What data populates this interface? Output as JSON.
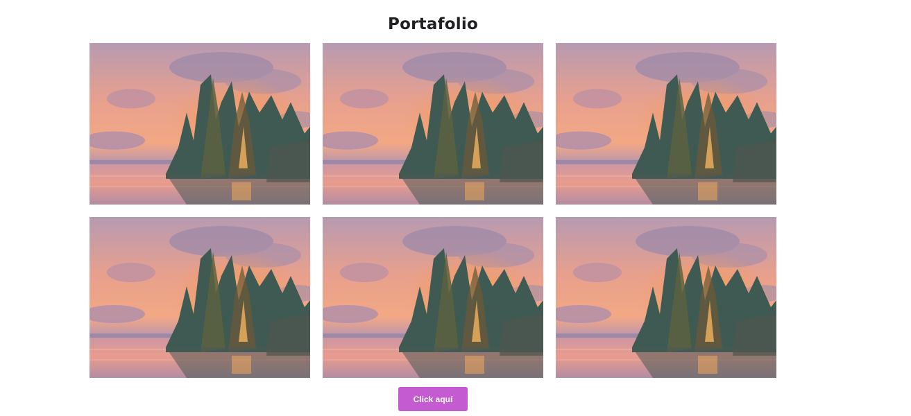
{
  "page": {
    "title": "Portafolio"
  },
  "gallery": {
    "items": [
      {
        "alt": "sunset-lake-painting"
      },
      {
        "alt": "sunset-lake-painting"
      },
      {
        "alt": "sunset-lake-painting"
      },
      {
        "alt": "sunset-lake-painting"
      },
      {
        "alt": "sunset-lake-painting"
      },
      {
        "alt": "sunset-lake-painting"
      }
    ]
  },
  "cta": {
    "label": "Click aquí",
    "color": "#c45bd0"
  }
}
